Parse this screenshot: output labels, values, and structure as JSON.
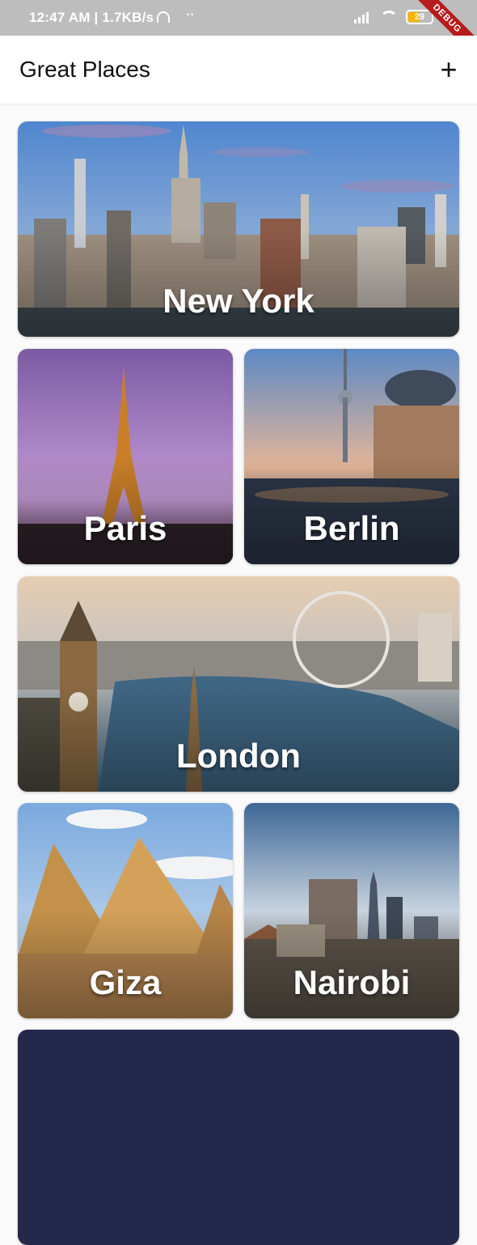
{
  "status_bar": {
    "time": "12:47 AM | 1.7KB/s",
    "dots": "··",
    "battery": "29",
    "debug_banner": "DEBUG"
  },
  "app_bar": {
    "title": "Great Places",
    "add_icon": "plus-icon",
    "add_label": "+"
  },
  "places": [
    {
      "name": "New York",
      "sky": "#5b8fd1",
      "ground": "#8c8880"
    },
    {
      "name": "Paris",
      "sky": "#9b6fb8",
      "ground": "#3a2a36"
    },
    {
      "name": "Berlin",
      "sky": "#6c96c9",
      "ground": "#2f3e52"
    },
    {
      "name": "London",
      "sky": "#e4d2b8",
      "ground": "#46607a"
    },
    {
      "name": "Giza",
      "sky": "#8cb6e3",
      "ground": "#c6974f"
    },
    {
      "name": "Nairobi",
      "sky": "#5d86b4",
      "ground": "#6b6256"
    }
  ]
}
